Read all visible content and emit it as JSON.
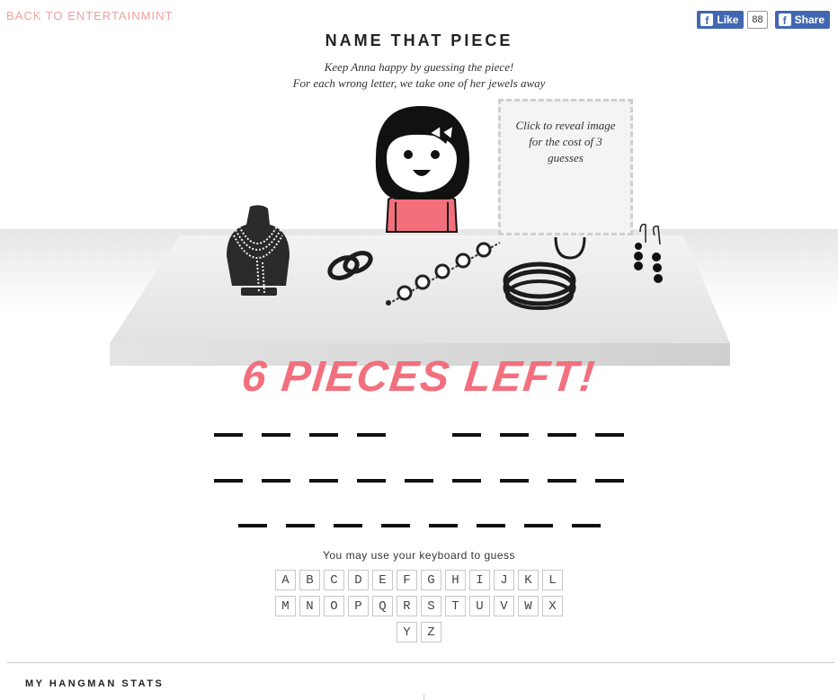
{
  "header": {
    "back_link": "BACK TO ENTERTAINMINT",
    "like_label": "Like",
    "like_count": "88",
    "share_label": "Share"
  },
  "game": {
    "title": "NAME THAT PIECE",
    "subtitle_line1": "Keep Anna happy by guessing the piece!",
    "subtitle_line2": "For each wrong letter, we take one of her jewels away",
    "reveal_text": "Click to reveal image for the cost of 3 guesses",
    "pieces_left": "6 PIECES LEFT!",
    "hint": "You may use your keyboard to guess"
  },
  "puzzle": {
    "rows": [
      [
        4,
        4
      ],
      [
        9
      ],
      [
        8
      ]
    ]
  },
  "keyboard": {
    "rows": [
      [
        "A",
        "B",
        "C",
        "D",
        "E",
        "F",
        "G",
        "H",
        "I",
        "J",
        "K",
        "L"
      ],
      [
        "M",
        "N",
        "O",
        "P",
        "Q",
        "R",
        "S",
        "T",
        "U",
        "V",
        "W",
        "X"
      ],
      [
        "Y",
        "Z"
      ]
    ]
  },
  "footer": {
    "stats_title": "MY HANGMAN STATS"
  },
  "icons": {
    "jewels": [
      "necklace-bust-icon",
      "rings-icon",
      "bracelet-icon",
      "bangles-icon",
      "hoop-earring-icon",
      "drop-earrings-icon"
    ],
    "character": "anna-avatar",
    "facebook": "facebook-f-icon"
  },
  "colors": {
    "accent_pink": "#f2707e",
    "back_link": "#f0a0a0",
    "facebook_blue": "#4267b2"
  }
}
